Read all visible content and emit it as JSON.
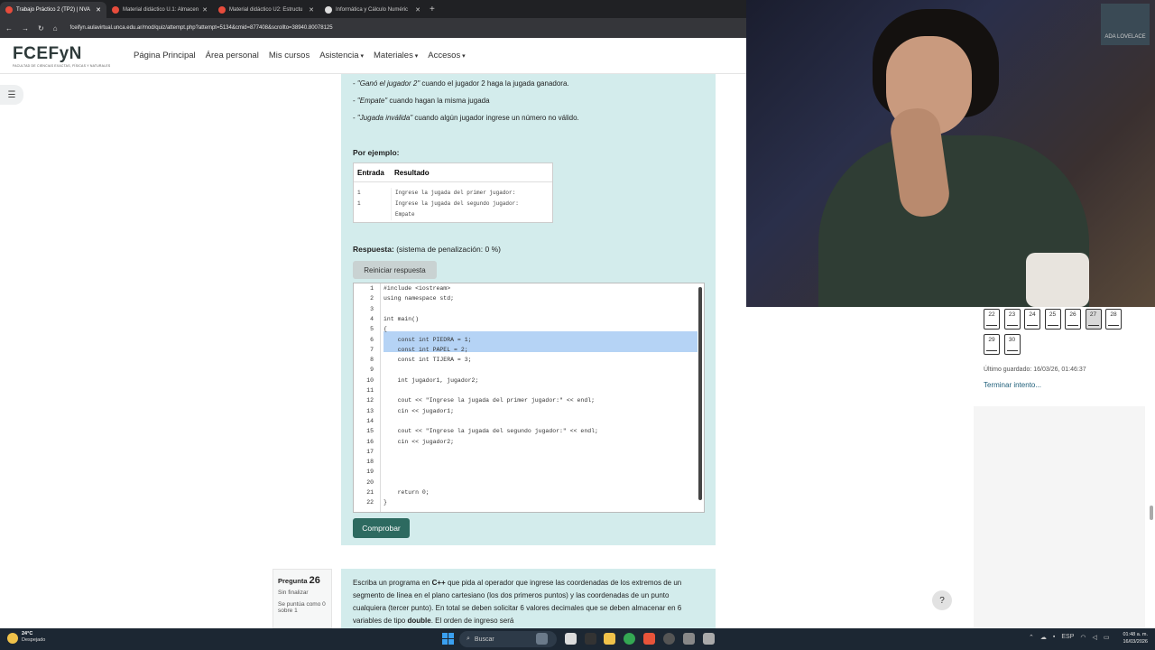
{
  "browser": {
    "tabs": [
      {
        "title": "Trabajo Práctico 2 (TP2) | NVA",
        "active": true
      },
      {
        "title": "Material didáctico U.1: Almacen",
        "active": false
      },
      {
        "title": "Material didáctico U2: Estructu",
        "active": false
      },
      {
        "title": "Informática y Cálculo Numéric",
        "active": false
      }
    ],
    "url": "fceifyn.aulavirtual.unca.edu.ar/mod/quiz/attempt.php?attempt=5134&cmid=877408&scrollto=38940.80078125"
  },
  "site": {
    "logo_main": "FCEFyN",
    "logo_sub": "FACULTAD DE CIENCIAS EXACTAS, FÍSICAS Y NATURALES",
    "nav": [
      "Página Principal",
      "Área personal",
      "Mis cursos",
      "Asistencia",
      "Materiales",
      "Accesos"
    ]
  },
  "question": {
    "lines": [
      {
        "prefix": "- ",
        "quote": "\"Ganó el jugador 2\"",
        "rest": " cuando el  jugador 2 haga la jugada ganadora."
      },
      {
        "prefix": "- ",
        "quote": "\"Empate\"",
        "rest": " cuando hagan la misma jugada"
      },
      {
        "prefix": "- ",
        "quote": "\"Jugada inválida\"",
        "rest": " cuando algún jugador ingrese un número no válido."
      }
    ],
    "example_title": "Por ejemplo:",
    "example_headers": [
      "Entrada",
      "Resultado"
    ],
    "example_input": [
      "1",
      "1"
    ],
    "example_output": [
      "Ingrese la jugada del primer jugador:",
      "Ingrese la jugada del segundo jugador:",
      "Empate"
    ],
    "answer_label": "Respuesta:",
    "penalty": "(sistema de penalización: 0 %)",
    "reset_label": "Reiniciar respuesta",
    "check_label": "Comprobar"
  },
  "code_lines": [
    "#include <iostream>",
    "using namespace std;",
    "",
    "int main()",
    "{",
    "    const int PIEDRA = 1;",
    "    const int PAPEL = 2;",
    "    const int TIJERA = 3;",
    "",
    "    int jugador1, jugador2;",
    "",
    "    cout << \"Ingrese la jugada del primer jugador:\" << endl;",
    "    cin << jugador1;",
    "",
    "    cout << \"Ingrese la jugada del segundo jugador:\" << endl;",
    "    cin << jugador2;",
    "",
    "",
    "",
    "",
    "    return 0;",
    "}"
  ],
  "line_numbers": [
    "1",
    "2",
    "3",
    "4",
    "5",
    "6",
    "7",
    "8",
    "9",
    "10",
    "11",
    "12",
    "13",
    "14",
    "15",
    "16",
    "17",
    "18",
    "19",
    "20",
    "21",
    "22"
  ],
  "next_question": {
    "label": "Pregunta",
    "number": "26",
    "status": "Sin finalizar",
    "score": "Se puntúa como 0 sobre 1",
    "text_1": "Escriba un programa en ",
    "text_lang": "C++",
    "text_2": " que pida al operador que ingrese las coordenadas de los extremos de un segmento de línea en el plano cartesiano (los dos primeros puntos) y las coordenadas de un punto cualquiera (tercer punto). En total se deben solicitar 6 valores decimales que se deben almacenar en 6 variables de tipo ",
    "text_type": "double",
    "text_3": ". El orden de ingreso será"
  },
  "quiz_nav": {
    "row1": [
      "22",
      "23",
      "24",
      "25",
      "26",
      "27",
      "28"
    ],
    "row2": [
      "29",
      "30"
    ],
    "current": "27",
    "saved": "Último guardado: 16/03/26, 01:46:37",
    "finish": "Terminar intento..."
  },
  "webcam": {
    "poster_text": "ADA LOVELACE"
  },
  "taskbar": {
    "temp": "24°C",
    "weather": "Despejado",
    "search": "Buscar",
    "lang": "ESP",
    "time": "01:48 a. m.",
    "date": "16/03/2026"
  },
  "help": "?"
}
